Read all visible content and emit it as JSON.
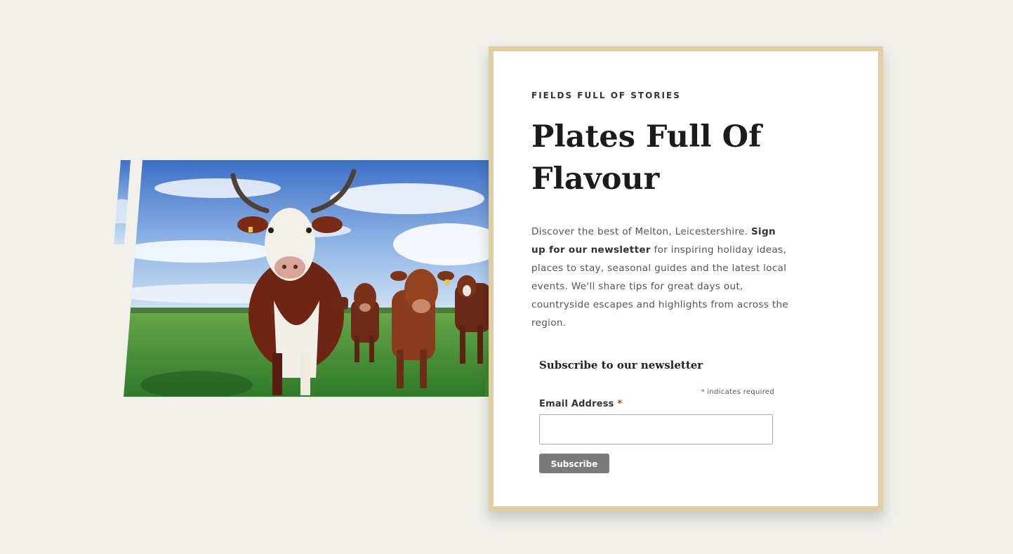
{
  "card": {
    "eyebrow": "FIELDS FULL OF STORIES",
    "title_line1": "Plates Full Of",
    "title_line2": "Flavour",
    "intro_start": "Discover the best of Melton, Leicestershire. ",
    "intro_bold": "Sign up for our newsletter",
    "intro_end": " for inspiring holiday ideas, places to stay, seasonal guides and the latest local events. We'll share tips for great days out, countryside escapes and highlights from across the region."
  },
  "form": {
    "title": "Subscribe to our newsletter",
    "required_asterisk": "*",
    "required_note": " indicates required",
    "email_label": "Email Address",
    "email_value": "",
    "email_placeholder": "",
    "subscribe_label": "Subscribe"
  },
  "image": {
    "subject": "cows in a field under a blue sky"
  },
  "colors": {
    "background": "#f1f0eb",
    "card_border": "#e1cfa3",
    "button": "#7a7a7a",
    "required": "#c8391d"
  }
}
